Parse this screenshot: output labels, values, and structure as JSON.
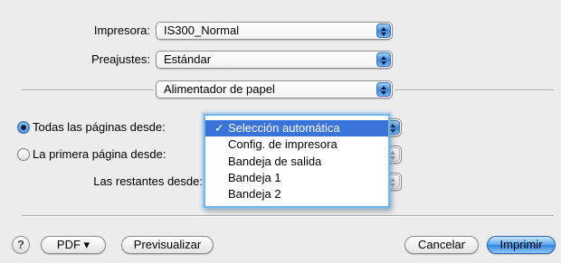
{
  "printer": {
    "label": "Impresora:",
    "value": "IS300_Normal"
  },
  "presets": {
    "label": "Preajustes:",
    "value": "Estándar"
  },
  "panel": {
    "value": "Alimentador de papel"
  },
  "paper_feed": {
    "all_pages_label": "Todas las páginas desde:",
    "first_page_label": "La primera página desde:",
    "remaining_label": "Las restantes desde:",
    "all_pages_selected": true,
    "menu": {
      "items": [
        {
          "label": "Selección automática",
          "checked": true
        },
        {
          "label": "Config. de impresora",
          "checked": false
        },
        {
          "label": "Bandeja de salida",
          "checked": false
        },
        {
          "label": "Bandeja 1",
          "checked": false
        },
        {
          "label": "Bandeja 2",
          "checked": false
        }
      ],
      "check_glyph": "✓"
    }
  },
  "buttons": {
    "help": "?",
    "pdf": "PDF ▾",
    "preview": "Previsualizar",
    "cancel": "Cancelar",
    "print": "Imprimir"
  },
  "colors": {
    "accent": "#3a74d8",
    "default_button": "#2f82e0",
    "menu_glow": "#6fb6ec"
  }
}
